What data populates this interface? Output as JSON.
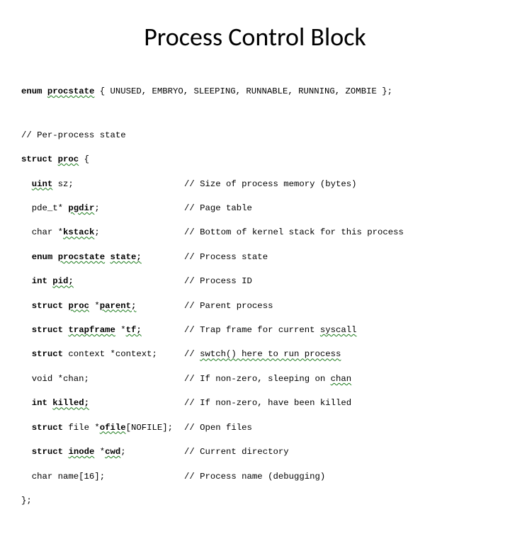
{
  "title": "Process Control Block",
  "enum_line_parts": {
    "p1": "enum",
    "p2": " ",
    "p3": "procstate",
    "p4": " { UNUSED, EMBRYO, SLEEPING, RUNNABLE, RUNNING, ZOMBIE };"
  },
  "comment_header": "// Per-process state",
  "struct_open_parts": {
    "p1": "struct",
    "p2": " ",
    "p3": "proc",
    "p4": " {"
  },
  "fields": [
    {
      "decl_a": "  ",
      "decl_b": "uint",
      "decl_c": " sz;",
      "hl": false,
      "cmt": "// Size of process memory (bytes)"
    },
    {
      "decl_a": "  pde_t* ",
      "decl_b": "pgdir",
      "decl_c": ";",
      "hl": false,
      "cmt": "// Page table"
    },
    {
      "decl_a": "  char *",
      "decl_b": "kstack",
      "decl_c": ";",
      "hl": false,
      "cmt": "// Bottom of kernel stack for this process"
    },
    {
      "decl_a": "  ",
      "decl_b": "enum",
      "decl_c": " ",
      "decl_d": "procstate",
      "decl_e": " ",
      "decl_f": "state;",
      "hl": true,
      "cmt": "// Process state"
    },
    {
      "decl_a": "  ",
      "decl_b": "int",
      "decl_c": " ",
      "decl_d": "pid;",
      "hl": true,
      "cmt": "// Process ID"
    },
    {
      "decl_a": "  ",
      "decl_b": "struct",
      "decl_c": " ",
      "decl_d": "proc",
      "decl_e": " *",
      "decl_f": "parent;",
      "hl": true,
      "cmt": "// Parent process"
    },
    {
      "decl_a": "  ",
      "decl_b": "struct",
      "decl_c": " ",
      "decl_d": "trapframe",
      "decl_e": " *",
      "decl_f": "tf;",
      "hl": true,
      "cmt_a": "// Trap frame for current ",
      "cmt_b": "syscall"
    },
    {
      "decl_a": "  ",
      "decl_b": "struct",
      "decl_c": " context *context;",
      "hl": false,
      "cmt_a": "// ",
      "cmt_b": "swtch() here to run process"
    },
    {
      "decl_a": "  void *chan;",
      "hl": false,
      "cmt_a": "// If non-zero, sleeping on ",
      "cmt_b": "chan"
    },
    {
      "decl_a": "  ",
      "decl_b": "int",
      "decl_c": " ",
      "decl_d": "killed;",
      "hl": true,
      "cmt": "// If non-zero, have been killed"
    },
    {
      "decl_a": "  ",
      "decl_b": "struct",
      "decl_c": " file *",
      "decl_d": "ofile",
      "decl_e": "[NOFILE];",
      "hl": false,
      "cmt": "// Open files"
    },
    {
      "decl_a": "  ",
      "decl_b": "struct",
      "decl_c": " ",
      "decl_d": "inode",
      "decl_e": " *",
      "decl_f": "cwd",
      "decl_g": ";",
      "hl": false,
      "cmt": "// Current directory"
    },
    {
      "decl_a": "  char name[16];",
      "hl": false,
      "cmt": "// Process name (debugging)"
    }
  ],
  "struct_close": "};"
}
